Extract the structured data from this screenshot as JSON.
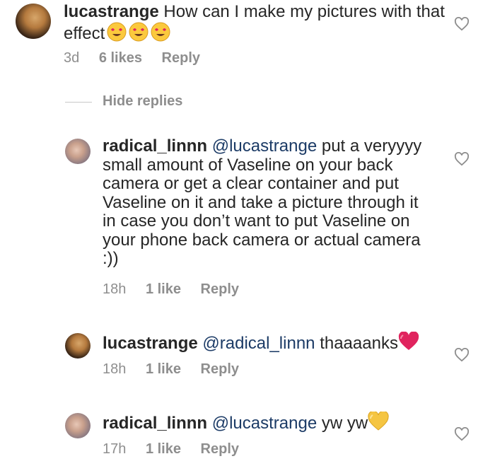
{
  "comments": [
    {
      "username": "lucastrange",
      "text": "How can I make my pictures with that effect",
      "time": "3d",
      "likes": "6 likes",
      "reply": "Reply",
      "emoji_names": [
        "heart-eyes-emoji",
        "heart-eyes-emoji",
        "heart-eyes-emoji"
      ]
    },
    {
      "username": "radical_linnn",
      "mention": "@lucastrange",
      "text_lines": [
        "put a veryyyy",
        "small amount of Vaseline on your back",
        "camera or get a clear container and put",
        "Vaseline on it and take a picture through it",
        "in case you don’t want to put Vaseline on",
        "your phone back camera or actual camera",
        ":))"
      ],
      "time": "18h",
      "likes": "1 like",
      "reply": "Reply"
    },
    {
      "username": "lucastrange",
      "mention": "@radical_linnn",
      "text": "thaaaanks",
      "emoji_name": "red-heart-emoji",
      "time": "18h",
      "likes": "1 like",
      "reply": "Reply"
    },
    {
      "username": "radical_linnn",
      "mention": "@lucastrange",
      "text": "yw yw",
      "emoji_name": "yellow-heart-emoji",
      "time": "17h",
      "likes": "1 like",
      "reply": "Reply"
    }
  ],
  "hide_replies_label": "Hide replies",
  "colors": {
    "text": "#262626",
    "muted": "#8e8e8e",
    "mention": "#1c3b66",
    "red_heart": "#e0245e",
    "yellow_heart": "#f5c542"
  }
}
